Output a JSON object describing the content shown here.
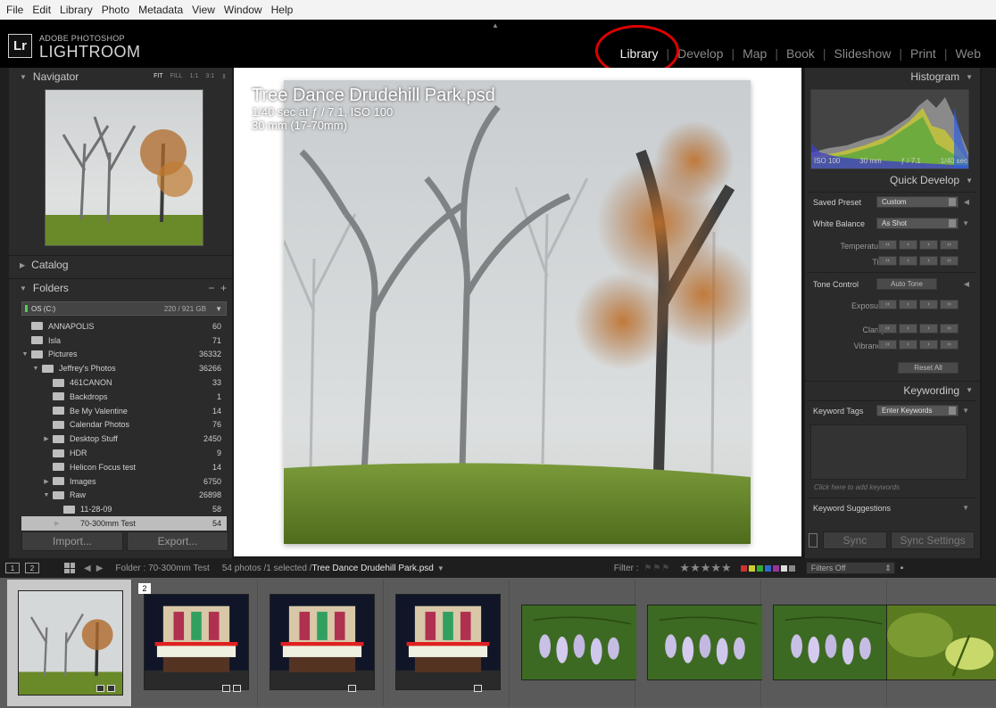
{
  "menu": [
    "File",
    "Edit",
    "Library",
    "Photo",
    "Metadata",
    "View",
    "Window",
    "Help"
  ],
  "brand": {
    "badge": "Lr",
    "line1": "ADOBE PHOTOSHOP",
    "line2": "LIGHTROOM"
  },
  "modules": [
    {
      "label": "Library",
      "active": true
    },
    {
      "label": "Develop",
      "active": false
    },
    {
      "label": "Map",
      "active": false
    },
    {
      "label": "Book",
      "active": false
    },
    {
      "label": "Slideshow",
      "active": false
    },
    {
      "label": "Print",
      "active": false
    },
    {
      "label": "Web",
      "active": false
    }
  ],
  "navigator": {
    "title": "Navigator",
    "zoom": [
      "FIT",
      "FILL",
      "1:1",
      "3:1"
    ],
    "zoom_active": "FIT"
  },
  "catalog": {
    "title": "Catalog"
  },
  "folders": {
    "title": "Folders",
    "volume": {
      "name": "OS (C:)",
      "size": "220 / 921 GB"
    },
    "items": [
      {
        "name": "ANNAPOLIS",
        "count": "60",
        "depth": 0,
        "expand": ""
      },
      {
        "name": "Isla",
        "count": "71",
        "depth": 0,
        "expand": ""
      },
      {
        "name": "Pictures",
        "count": "36332",
        "depth": 0,
        "expand": "▼"
      },
      {
        "name": "Jeffrey's Photos",
        "count": "36266",
        "depth": 1,
        "expand": "▼"
      },
      {
        "name": "461CANON",
        "count": "33",
        "depth": 2,
        "expand": ""
      },
      {
        "name": "Backdrops",
        "count": "1",
        "depth": 2,
        "expand": ""
      },
      {
        "name": "Be My Valentine",
        "count": "14",
        "depth": 2,
        "expand": ""
      },
      {
        "name": "Calendar Photos",
        "count": "76",
        "depth": 2,
        "expand": ""
      },
      {
        "name": "Desktop Stuff",
        "count": "2450",
        "depth": 2,
        "expand": "▶"
      },
      {
        "name": "HDR",
        "count": "9",
        "depth": 2,
        "expand": ""
      },
      {
        "name": "Helicon Focus test",
        "count": "14",
        "depth": 2,
        "expand": ""
      },
      {
        "name": "Images",
        "count": "6750",
        "depth": 2,
        "expand": "▶"
      },
      {
        "name": "Raw",
        "count": "26898",
        "depth": 2,
        "expand": "▼"
      },
      {
        "name": "11-28-09",
        "count": "58",
        "depth": 3,
        "expand": ""
      },
      {
        "name": "70-300mm Test",
        "count": "54",
        "depth": 3,
        "expand": "▶",
        "selected": true
      }
    ]
  },
  "buttons": {
    "import": "Import...",
    "export": "Export..."
  },
  "photo_info": {
    "title": "Tree Dance Drudehill Park.psd",
    "exposure": "1/40 sec at ƒ / 7.1, ISO 100",
    "lens": "30 mm (17-70mm)"
  },
  "histogram": {
    "title": "Histogram",
    "iso": "ISO 100",
    "focal": "30 mm",
    "aperture": "ƒ / 7.1",
    "shutter": "1/40 sec"
  },
  "quick_develop": {
    "title": "Quick Develop",
    "saved_preset_label": "Saved Preset",
    "saved_preset_value": "Custom",
    "white_balance_label": "White Balance",
    "white_balance_value": "As Shot",
    "temperature_label": "Temperature",
    "tint_label": "Tint",
    "tone_control_label": "Tone Control",
    "auto_tone": "Auto Tone",
    "exposure_label": "Exposure",
    "clarity_label": "Clarity",
    "vibrance_label": "Vibrance",
    "reset_all": "Reset All"
  },
  "keywording": {
    "title": "Keywording",
    "tags_label": "Keyword Tags",
    "tags_value": "Enter Keywords",
    "hint": "Click here to add keywords",
    "suggestions": "Keyword Suggestions"
  },
  "sync": {
    "sync": "Sync",
    "sync_settings": "Sync Settings"
  },
  "filmstrip_bar": {
    "screen1": "1",
    "screen2": "2",
    "folder": "Folder : 70-300mm Test",
    "count": "54 photos /1 selected /",
    "filename": "Tree Dance Drudehill Park.psd",
    "filter_label": "Filter :",
    "stars": "★★★★★",
    "filters_off": "Filters Off"
  },
  "filmstrip": [
    {
      "kind": "fog",
      "selected": true,
      "num": ""
    },
    {
      "kind": "theater",
      "selected": false,
      "num": "2"
    },
    {
      "kind": "theater",
      "selected": false,
      "num": ""
    },
    {
      "kind": "theater",
      "selected": false,
      "num": ""
    },
    {
      "kind": "flower",
      "selected": false,
      "num": ""
    },
    {
      "kind": "flower",
      "selected": false,
      "num": ""
    },
    {
      "kind": "flower",
      "selected": false,
      "num": ""
    },
    {
      "kind": "leaf",
      "selected": false,
      "num": ""
    }
  ],
  "colors": {
    "accent_circle": "#dd0000",
    "panel": "#2b2b2b",
    "selected_folder": "#bdbdbd"
  }
}
